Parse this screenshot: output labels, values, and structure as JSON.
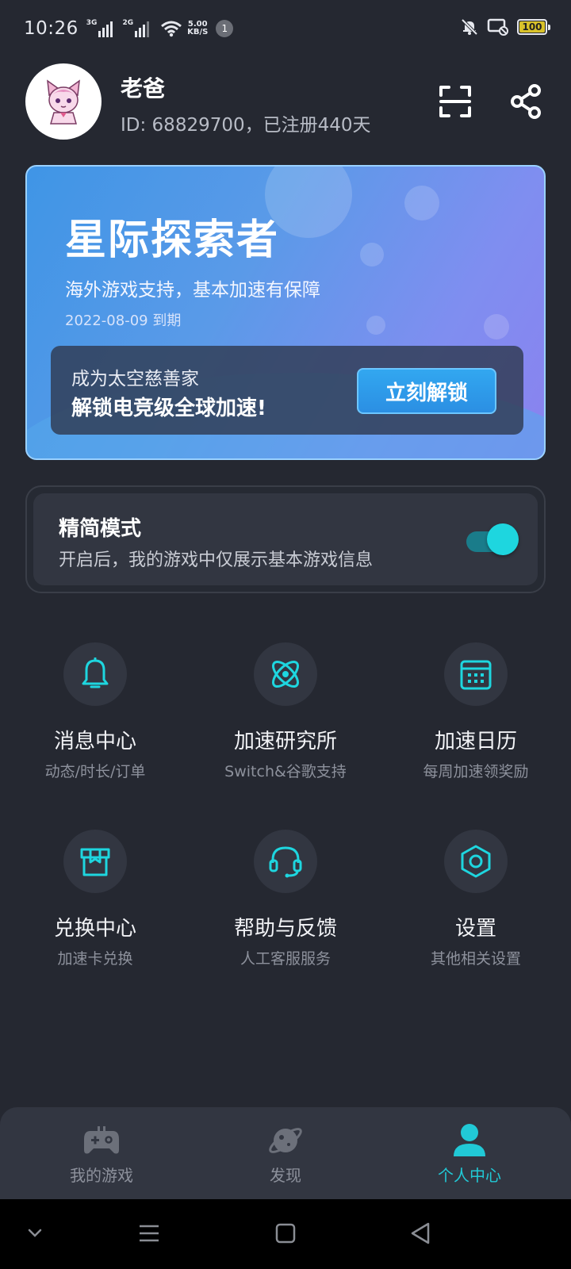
{
  "status_bar": {
    "time": "10:26",
    "signal1_tag": "3G",
    "signal2_tag": "2G",
    "net_speed_value": "5.00",
    "net_speed_unit": "KB/S",
    "notification_count": "1",
    "battery_level": "100"
  },
  "profile": {
    "name": "老爸",
    "id_line": "ID: 68829700，已注册440天"
  },
  "vip_card": {
    "title": "星际探索者",
    "description": "海外游戏支持，基本加速有保障",
    "expire": "2022-08-09 到期",
    "upgrade_line1": "成为太空慈善家",
    "upgrade_line2": "解锁电竞级全球加速!",
    "unlock_button": "立刻解锁"
  },
  "simple_mode": {
    "title": "精简模式",
    "description": "开启后，我的游戏中仅展示基本游戏信息",
    "enabled": true
  },
  "menu": [
    {
      "label": "消息中心",
      "sub": "动态/时长/订单",
      "icon": "bell-icon"
    },
    {
      "label": "加速研究所",
      "sub": "Switch&谷歌支持",
      "icon": "atom-icon"
    },
    {
      "label": "加速日历",
      "sub": "每周加速领奖励",
      "icon": "calendar-icon"
    },
    {
      "label": "兑换中心",
      "sub": "加速卡兑换",
      "icon": "gift-box-icon"
    },
    {
      "label": "帮助与反馈",
      "sub": "人工客服服务",
      "icon": "headset-icon"
    },
    {
      "label": "设置",
      "sub": "其他相关设置",
      "icon": "settings-hexagon-icon"
    }
  ],
  "bottom_nav": [
    {
      "label": "我的游戏",
      "icon": "gamepad-icon",
      "active": false
    },
    {
      "label": "发现",
      "icon": "planet-icon",
      "active": false
    },
    {
      "label": "个人中心",
      "icon": "person-icon",
      "active": true
    }
  ],
  "colors": {
    "background": "#252831",
    "card": "#323641",
    "accent": "#1ed6df",
    "active_nav": "#21c9d6"
  }
}
